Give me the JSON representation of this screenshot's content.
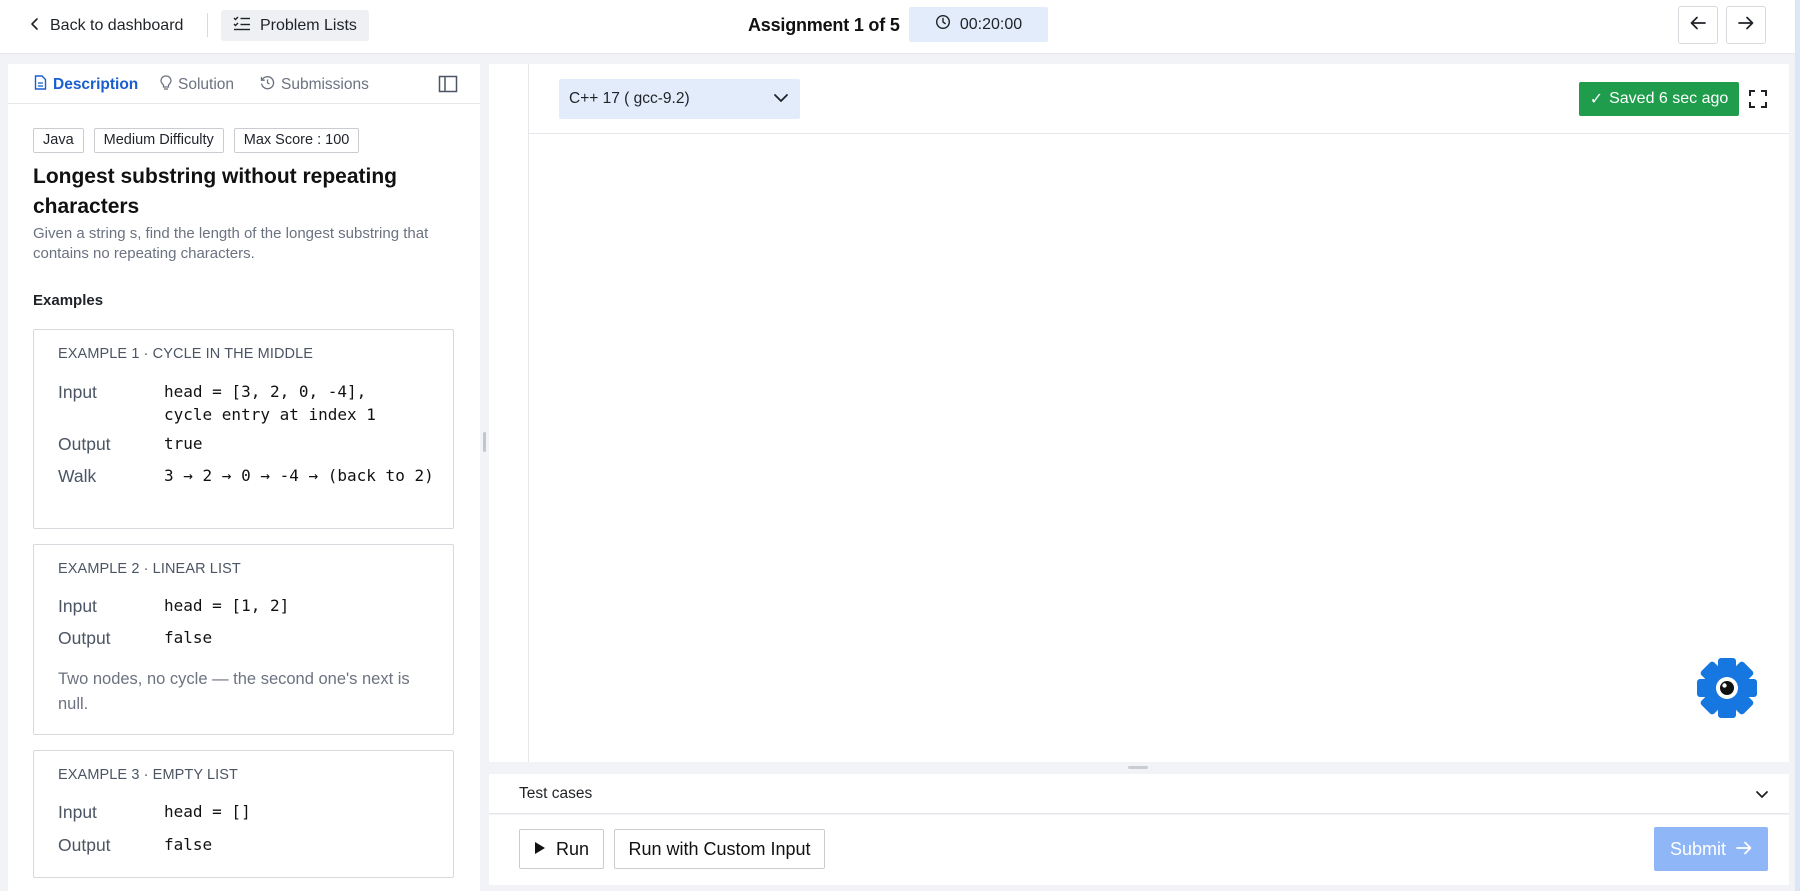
{
  "topbar": {
    "back_label": "Back to dashboard",
    "problem_lists_label": "Problem Lists",
    "assignment_title": "Assignment 1 of 5",
    "timer": "00:20:00"
  },
  "tabs": [
    {
      "label": "Description",
      "active": true,
      "icon": "document-icon"
    },
    {
      "label": "Solution",
      "active": false,
      "icon": "bulb-icon"
    },
    {
      "label": "Submissions",
      "active": false,
      "icon": "history-icon"
    }
  ],
  "problem": {
    "tags": [
      "Java",
      "Medium Difficulty",
      "Max Score : 100"
    ],
    "title": "Longest substring without repeating characters",
    "description": "Given a string s, find the length of the longest substring that contains no repeating characters.",
    "examples_heading": "Examples"
  },
  "examples": [
    {
      "title": "EXAMPLE 1 · CYCLE IN THE MIDDLE",
      "rows": [
        {
          "label": "Input",
          "value": "head = [3, 2, 0, -4],\ncycle entry at index 1"
        },
        {
          "label": "Output",
          "value": "true"
        },
        {
          "label": "Walk",
          "value": "3 → 2 → 0 → -4 → (back to 2)"
        }
      ]
    },
    {
      "title": "EXAMPLE 2 · LINEAR LIST",
      "rows": [
        {
          "label": "Input",
          "value": "head = [1, 2]"
        },
        {
          "label": "Output",
          "value": "false"
        }
      ],
      "note": "Two nodes, no cycle — the second one's next is null."
    },
    {
      "title": "EXAMPLE 3 · EMPTY LIST",
      "rows": [
        {
          "label": "Input",
          "value": "head = []"
        },
        {
          "label": "Output",
          "value": "false"
        }
      ]
    }
  ],
  "editor": {
    "language": "C++ 17 ( gcc-9.2)",
    "saved_status": "Saved 6 sec ago",
    "saved_check": "✓"
  },
  "testcases": {
    "label": "Test cases"
  },
  "actions": {
    "run_label": "Run",
    "custom_label": "Run with Custom Input",
    "submit_label": "Submit"
  },
  "colors": {
    "accent": "#1a5fd0",
    "saved_green": "#1f9d4c",
    "submit_disabled": "#8fb6f7",
    "select_bg": "#e3ecfa",
    "bot_blue": "#1677e0"
  }
}
